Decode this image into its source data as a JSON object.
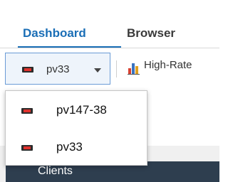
{
  "tabs": [
    {
      "label": "Dashboard",
      "active": true
    },
    {
      "label": "Browser",
      "active": false
    }
  ],
  "toolbar": {
    "device_select": {
      "selected": "pv33",
      "icon": "device-icon"
    },
    "high_rate_label": "High-Rate",
    "high_rate_icon": "bar-chart-icon"
  },
  "dropdown": {
    "options": [
      {
        "label": "pv147-38",
        "icon": "device-icon"
      },
      {
        "label": "pv33",
        "icon": "device-icon"
      }
    ]
  },
  "panel": {
    "title": "Clients"
  },
  "colors": {
    "accent": "#1a6eb6",
    "panel_header": "#2e3e4f",
    "device_icon_red": "#e0322d"
  }
}
